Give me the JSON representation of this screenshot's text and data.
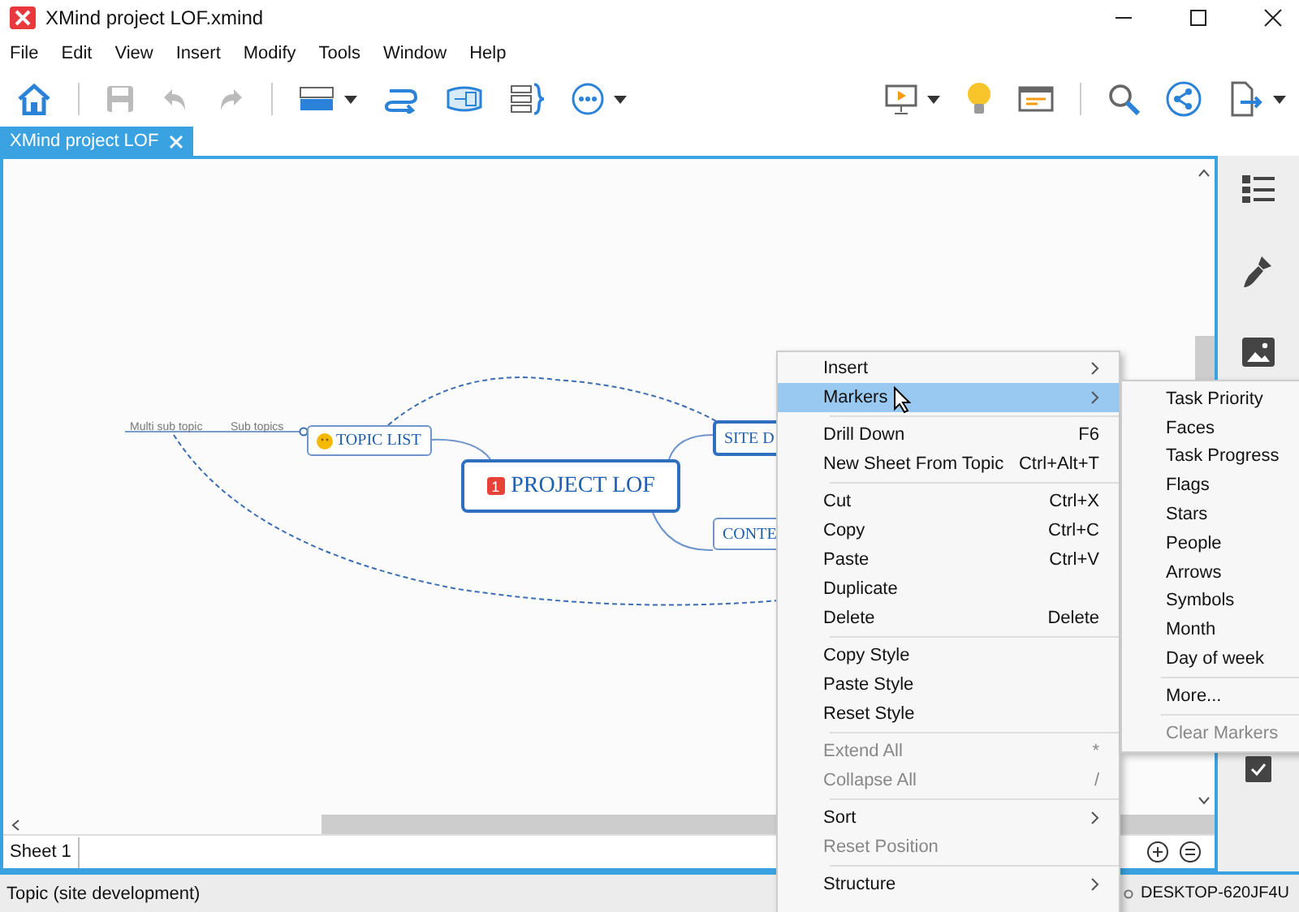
{
  "window": {
    "title": "XMind project LOF.xmind"
  },
  "menu_bar": [
    "File",
    "Edit",
    "View",
    "Insert",
    "Modify",
    "Tools",
    "Window",
    "Help"
  ],
  "toolbar": [
    {
      "kind": "home",
      "disabled": false
    },
    {
      "kind": "separator"
    },
    {
      "kind": "save",
      "disabled": true
    },
    {
      "kind": "undo",
      "disabled": true
    },
    {
      "kind": "redo",
      "disabled": true
    },
    {
      "kind": "separator"
    },
    {
      "kind": "topic",
      "disabled": false,
      "dropdown": true
    },
    {
      "kind": "relationship",
      "disabled": false
    },
    {
      "kind": "boundary",
      "disabled": false
    },
    {
      "kind": "summary",
      "disabled": false
    },
    {
      "kind": "more",
      "disabled": false,
      "dropdown": true
    },
    {
      "kind": "spacer"
    },
    {
      "kind": "presentation",
      "disabled": false,
      "dropdown": true
    },
    {
      "kind": "idea",
      "disabled": false
    },
    {
      "kind": "panel",
      "disabled": false
    },
    {
      "kind": "separator"
    },
    {
      "kind": "search",
      "disabled": false
    },
    {
      "kind": "share",
      "disabled": false
    },
    {
      "kind": "export",
      "disabled": false,
      "dropdown": true
    }
  ],
  "editor_tab": {
    "label": "XMind project LOF",
    "selected": true
  },
  "mind_map": {
    "central": {
      "label": "PROJECT LOF",
      "priority": "1"
    },
    "topics": [
      {
        "label": "TOPIC LIST",
        "selected": false,
        "face_marker": true
      },
      {
        "label": "SITE D",
        "selected": true,
        "face_marker": false
      },
      {
        "label": "CONTE",
        "selected": false,
        "face_marker": false
      }
    ],
    "subtopics": [
      "Multi sub topic",
      "Sub topics"
    ]
  },
  "sheet_tabs": [
    {
      "label": "Sheet 1",
      "selected": true
    }
  ],
  "status_bar": {
    "text": "Topic (site development)",
    "host": "DESKTOP-620JF4U"
  },
  "context_menu": [
    {
      "kind": "item",
      "label": "Insert",
      "submenu": true,
      "disabled": false,
      "selected": false
    },
    {
      "kind": "item",
      "label": "Markers",
      "submenu": true,
      "disabled": false,
      "selected": true
    },
    {
      "kind": "separator"
    },
    {
      "kind": "item",
      "label": "Drill Down",
      "shortcut": "F6",
      "disabled": false,
      "selected": false
    },
    {
      "kind": "item",
      "label": "New Sheet From Topic",
      "shortcut": "Ctrl+Alt+T",
      "disabled": false,
      "selected": false
    },
    {
      "kind": "separator"
    },
    {
      "kind": "item",
      "label": "Cut",
      "shortcut": "Ctrl+X",
      "disabled": false,
      "selected": false
    },
    {
      "kind": "item",
      "label": "Copy",
      "shortcut": "Ctrl+C",
      "disabled": false,
      "selected": false
    },
    {
      "kind": "item",
      "label": "Paste",
      "shortcut": "Ctrl+V",
      "disabled": false,
      "selected": false
    },
    {
      "kind": "item",
      "label": "Duplicate",
      "disabled": false,
      "selected": false
    },
    {
      "kind": "item",
      "label": "Delete",
      "shortcut": "Delete",
      "disabled": false,
      "selected": false
    },
    {
      "kind": "separator"
    },
    {
      "kind": "item",
      "label": "Copy Style",
      "disabled": false,
      "selected": false
    },
    {
      "kind": "item",
      "label": "Paste Style",
      "disabled": false,
      "selected": false
    },
    {
      "kind": "item",
      "label": "Reset Style",
      "disabled": false,
      "selected": false
    },
    {
      "kind": "separator"
    },
    {
      "kind": "item",
      "label": "Extend All",
      "shortcut": "*",
      "disabled": true,
      "selected": false
    },
    {
      "kind": "item",
      "label": "Collapse All",
      "shortcut": "/",
      "disabled": true,
      "selected": false
    },
    {
      "kind": "separator"
    },
    {
      "kind": "item",
      "label": "Sort",
      "submenu": true,
      "disabled": false,
      "selected": false
    },
    {
      "kind": "item",
      "label": "Reset Position",
      "disabled": true,
      "selected": false
    },
    {
      "kind": "separator"
    },
    {
      "kind": "item",
      "label": "Structure",
      "submenu": true,
      "disabled": false,
      "selected": false
    }
  ],
  "markers_submenu": [
    {
      "kind": "item",
      "label": "Task Priority",
      "disabled": false
    },
    {
      "kind": "item",
      "label": "Faces",
      "disabled": false
    },
    {
      "kind": "item",
      "label": "Task Progress",
      "disabled": false
    },
    {
      "kind": "item",
      "label": "Flags",
      "disabled": false
    },
    {
      "kind": "item",
      "label": "Stars",
      "disabled": false
    },
    {
      "kind": "item",
      "label": "People",
      "disabled": false
    },
    {
      "kind": "item",
      "label": "Arrows",
      "disabled": false
    },
    {
      "kind": "item",
      "label": "Symbols",
      "disabled": false
    },
    {
      "kind": "item",
      "label": "Month",
      "disabled": false
    },
    {
      "kind": "item",
      "label": "Day of week",
      "disabled": false
    },
    {
      "kind": "separator"
    },
    {
      "kind": "item",
      "label": "More...",
      "disabled": false
    },
    {
      "kind": "separator"
    },
    {
      "kind": "item",
      "label": "Clear Markers",
      "disabled": true
    }
  ]
}
